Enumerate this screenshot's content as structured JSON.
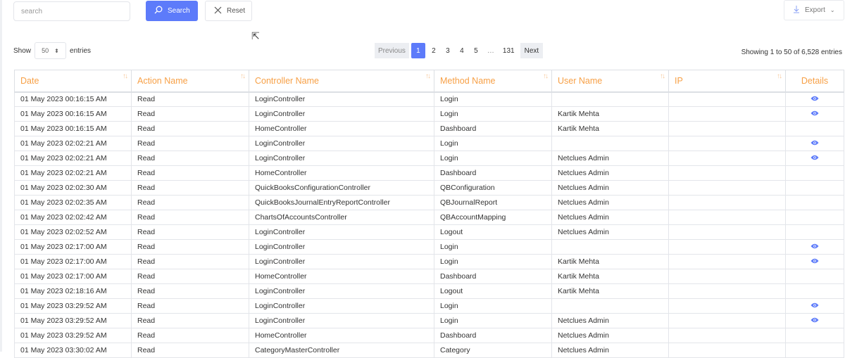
{
  "search": {
    "placeholder": "search",
    "button": "Search",
    "reset": "Reset"
  },
  "export": {
    "label": "Export"
  },
  "length": {
    "show": "Show",
    "value": "50",
    "entries": "entries"
  },
  "pagination": {
    "previous": "Previous",
    "pages": [
      "1",
      "2",
      "3",
      "4",
      "5",
      "…",
      "131"
    ],
    "next": "Next",
    "active": "1"
  },
  "info": "Showing 1 to 50 of 6,528 entries",
  "columns": [
    "Date",
    "Action Name",
    "Controller Name",
    "Method Name",
    "User Name",
    "IP",
    "Details"
  ],
  "rows": [
    [
      "01 May 2023 00:16:15 AM",
      "Read",
      "LoginController",
      "Login",
      "",
      "",
      true
    ],
    [
      "01 May 2023 00:16:15 AM",
      "Read",
      "LoginController",
      "Login",
      "Kartik Mehta",
      "",
      true
    ],
    [
      "01 May 2023 00:16:15 AM",
      "Read",
      "HomeController",
      "Dashboard",
      "Kartik Mehta",
      "",
      false
    ],
    [
      "01 May 2023 02:02:21 AM",
      "Read",
      "LoginController",
      "Login",
      "",
      "",
      true
    ],
    [
      "01 May 2023 02:02:21 AM",
      "Read",
      "LoginController",
      "Login",
      "Netclues Admin",
      "",
      true
    ],
    [
      "01 May 2023 02:02:21 AM",
      "Read",
      "HomeController",
      "Dashboard",
      "Netclues Admin",
      "",
      false
    ],
    [
      "01 May 2023 02:02:30 AM",
      "Read",
      "QuickBooksConfigurationController",
      "QBConfiguration",
      "Netclues Admin",
      "",
      false
    ],
    [
      "01 May 2023 02:02:35 AM",
      "Read",
      "QuickBooksJournalEntryReportController",
      "QBJournalReport",
      "Netclues Admin",
      "",
      false
    ],
    [
      "01 May 2023 02:02:42 AM",
      "Read",
      "ChartsOfAccountsController",
      "QBAccountMapping",
      "Netclues Admin",
      "",
      false
    ],
    [
      "01 May 2023 02:02:52 AM",
      "Read",
      "LoginController",
      "Logout",
      "Netclues Admin",
      "",
      false
    ],
    [
      "01 May 2023 02:17:00 AM",
      "Read",
      "LoginController",
      "Login",
      "",
      "",
      true
    ],
    [
      "01 May 2023 02:17:00 AM",
      "Read",
      "LoginController",
      "Login",
      "Kartik Mehta",
      "",
      true
    ],
    [
      "01 May 2023 02:17:00 AM",
      "Read",
      "HomeController",
      "Dashboard",
      "Kartik Mehta",
      "",
      false
    ],
    [
      "01 May 2023 02:18:16 AM",
      "Read",
      "LoginController",
      "Logout",
      "Kartik Mehta",
      "",
      false
    ],
    [
      "01 May 2023 03:29:52 AM",
      "Read",
      "LoginController",
      "Login",
      "",
      "",
      true
    ],
    [
      "01 May 2023 03:29:52 AM",
      "Read",
      "LoginController",
      "Login",
      "Netclues Admin",
      "",
      true
    ],
    [
      "01 May 2023 03:29:52 AM",
      "Read",
      "HomeController",
      "Dashboard",
      "Netclues Admin",
      "",
      false
    ],
    [
      "01 May 2023 03:30:02 AM",
      "Read",
      "CategoryMasterController",
      "Category",
      "Netclues Admin",
      "",
      false
    ]
  ]
}
